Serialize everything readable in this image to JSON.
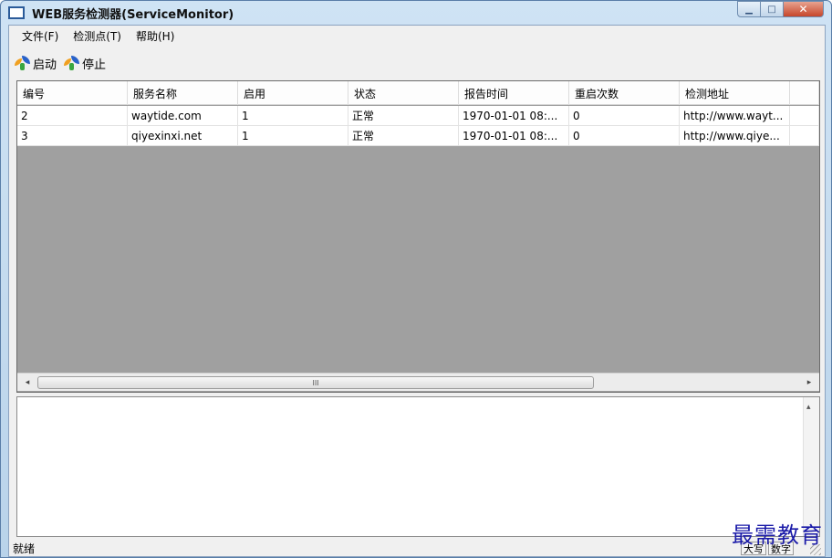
{
  "window": {
    "title": "WEB服务检测器(ServiceMonitor)",
    "controls": {
      "minimize": "▁",
      "maximize": "□",
      "close": "✕"
    }
  },
  "menubar": [
    {
      "label": "文件(F)"
    },
    {
      "label": "检测点(T)"
    },
    {
      "label": "帮助(H)"
    }
  ],
  "toolbar": [
    {
      "label": "启动",
      "icon": "start-icon"
    },
    {
      "label": "停止",
      "icon": "stop-icon"
    }
  ],
  "table": {
    "columns": [
      "编号",
      "服务名称",
      "启用",
      "状态",
      "报告时间",
      "重启次数",
      "检测地址"
    ],
    "rows": [
      [
        "2",
        "waytide.com",
        "1",
        "正常",
        "1970-01-01 08:...",
        "0",
        "http://www.wayt..."
      ],
      [
        "3",
        "qiyexinxi.net",
        "1",
        "正常",
        "1970-01-01 08:...",
        "0",
        "http://www.qiye..."
      ]
    ]
  },
  "scrollbar": {
    "left_arrow": "◂",
    "right_arrow": "▸",
    "thumb_grip": "III",
    "up_arrow": "▴"
  },
  "statusbar": {
    "text": "就绪",
    "panes": [
      "大写",
      "数字"
    ]
  },
  "watermark": "最需教育",
  "colors": {
    "list_empty_bg": "#a0a0a0",
    "titlebar": "#b9d3ea",
    "watermark": "#1a1aa8"
  }
}
